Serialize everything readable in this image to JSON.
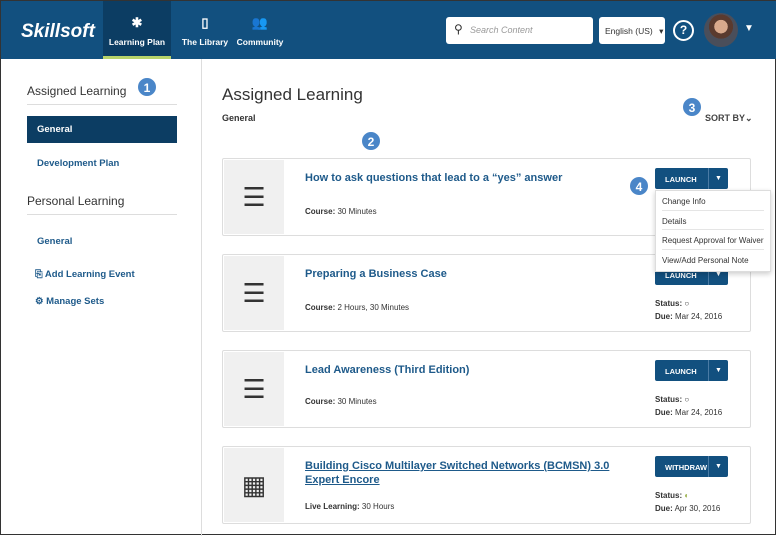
{
  "header": {
    "logo": "Skillsoft",
    "nav": [
      {
        "label": "Learning Plan",
        "icon": "puzzle-icon"
      },
      {
        "label": "The Library",
        "icon": "book-icon"
      },
      {
        "label": "Community",
        "icon": "people-icon"
      }
    ],
    "search_placeholder": "Search Content",
    "language": "English (US)",
    "help": "?"
  },
  "sidebar": {
    "assigned_heading": "Assigned Learning",
    "assigned_items": [
      "General",
      "Development Plan"
    ],
    "personal_heading": "Personal Learning",
    "personal_items": [
      "General"
    ],
    "add_event": "Add Learning Event",
    "manage_sets": "Manage Sets"
  },
  "badges": [
    "1",
    "2",
    "3",
    "4"
  ],
  "main": {
    "title": "Assigned Learning",
    "subtitle": "General",
    "sort": "SORT BY",
    "cards": [
      {
        "title": "How to ask questions that lead to a “yes” answer",
        "type": "Course:",
        "duration": "30 Minutes",
        "action": "LAUNCH"
      },
      {
        "title": "Preparing a Business Case",
        "type": "Course:",
        "duration": "2 Hours, 30 Minutes",
        "action": "LAUNCH",
        "status_label": "Status:",
        "due_label": "Due:",
        "due": "Mar 24, 2016"
      },
      {
        "title": "Lead Awareness (Third Edition)",
        "type": "Course:",
        "duration": "30 Minutes",
        "action": "LAUNCH",
        "status_label": "Status:",
        "due_label": "Due:",
        "due": "Mar 24, 2016"
      },
      {
        "title": "Building Cisco Multilayer Switched Networks (BCMSN) 3.0 Expert Encore",
        "type": "Live Learning:",
        "duration": "30 Hours",
        "action": "WITHDRAW",
        "status_label": "Status:",
        "due_label": "Due:",
        "due": "Apr 30, 2016"
      }
    ]
  },
  "dropdown": [
    "Change Info",
    "Details",
    "Request Approval for Waiver",
    "View/Add Personal Note"
  ]
}
